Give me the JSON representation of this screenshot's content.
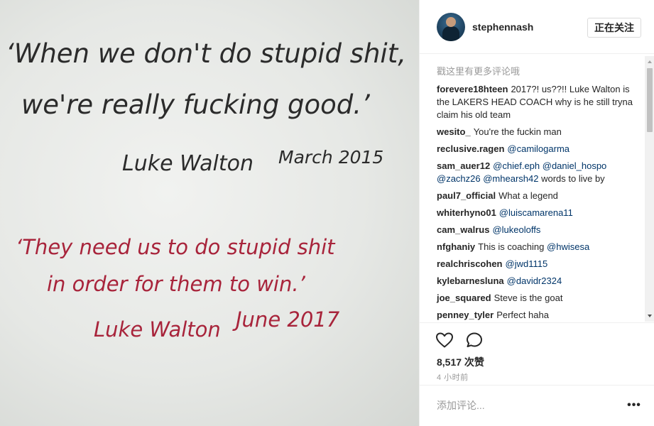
{
  "photo": {
    "quote1_line1": "‘When we don't do stupid shit,",
    "quote1_line2": "we're really fucking good.’",
    "quote1_author": "Luke Walton",
    "quote1_date": "March 2015",
    "quote2_line1": "‘They need us to do stupid shit",
    "quote2_line2": "in order for them to win.’",
    "quote2_author": "Luke Walton",
    "quote2_date": "June 2017",
    "colors": {
      "black_ink": "#2b2b2b",
      "red_ink": "#a8243b"
    }
  },
  "header": {
    "username": "stephennash",
    "follow_label": "正在关注"
  },
  "comments": {
    "load_more": "戳这里有更多评论哦",
    "items": [
      {
        "user": "forevere18hteen",
        "text": "2017?! us??!! Luke Walton is the LAKERS HEAD COACH why is he still tryna claim his old team"
      },
      {
        "user": "wesito_",
        "text": "You're the fuckin man"
      },
      {
        "user": "reclusive.ragen",
        "mentions": "@camilogarma"
      },
      {
        "user": "sam_auer12",
        "mentions": "@chief.eph @daniel_hospo @zachz26 @mhearsh42",
        "text": "words to live by"
      },
      {
        "user": "paul7_official",
        "text": "What a legend"
      },
      {
        "user": "whiterhyno01",
        "mentions": "@luiscamarena11"
      },
      {
        "user": "cam_walrus",
        "mentions": "@lukeoloffs"
      },
      {
        "user": "nfghaniy",
        "text": "This is coaching",
        "mentions": "@hwisesa"
      },
      {
        "user": "realchriscohen",
        "mentions": "@jwd1115"
      },
      {
        "user": "kylebarnesluna",
        "mentions": "@davidr2324"
      },
      {
        "user": "joe_squared",
        "text": "Steve is the goat"
      },
      {
        "user": "penney_tyler",
        "text": "Perfect haha"
      }
    ]
  },
  "actions": {
    "like_icon": "heart-icon",
    "comment_icon": "speech-bubble-icon",
    "likes_text": "8,517 次赞",
    "timestamp": "4 小时前"
  },
  "add_comment": {
    "placeholder": "添加评论...",
    "more_label": "•••"
  }
}
